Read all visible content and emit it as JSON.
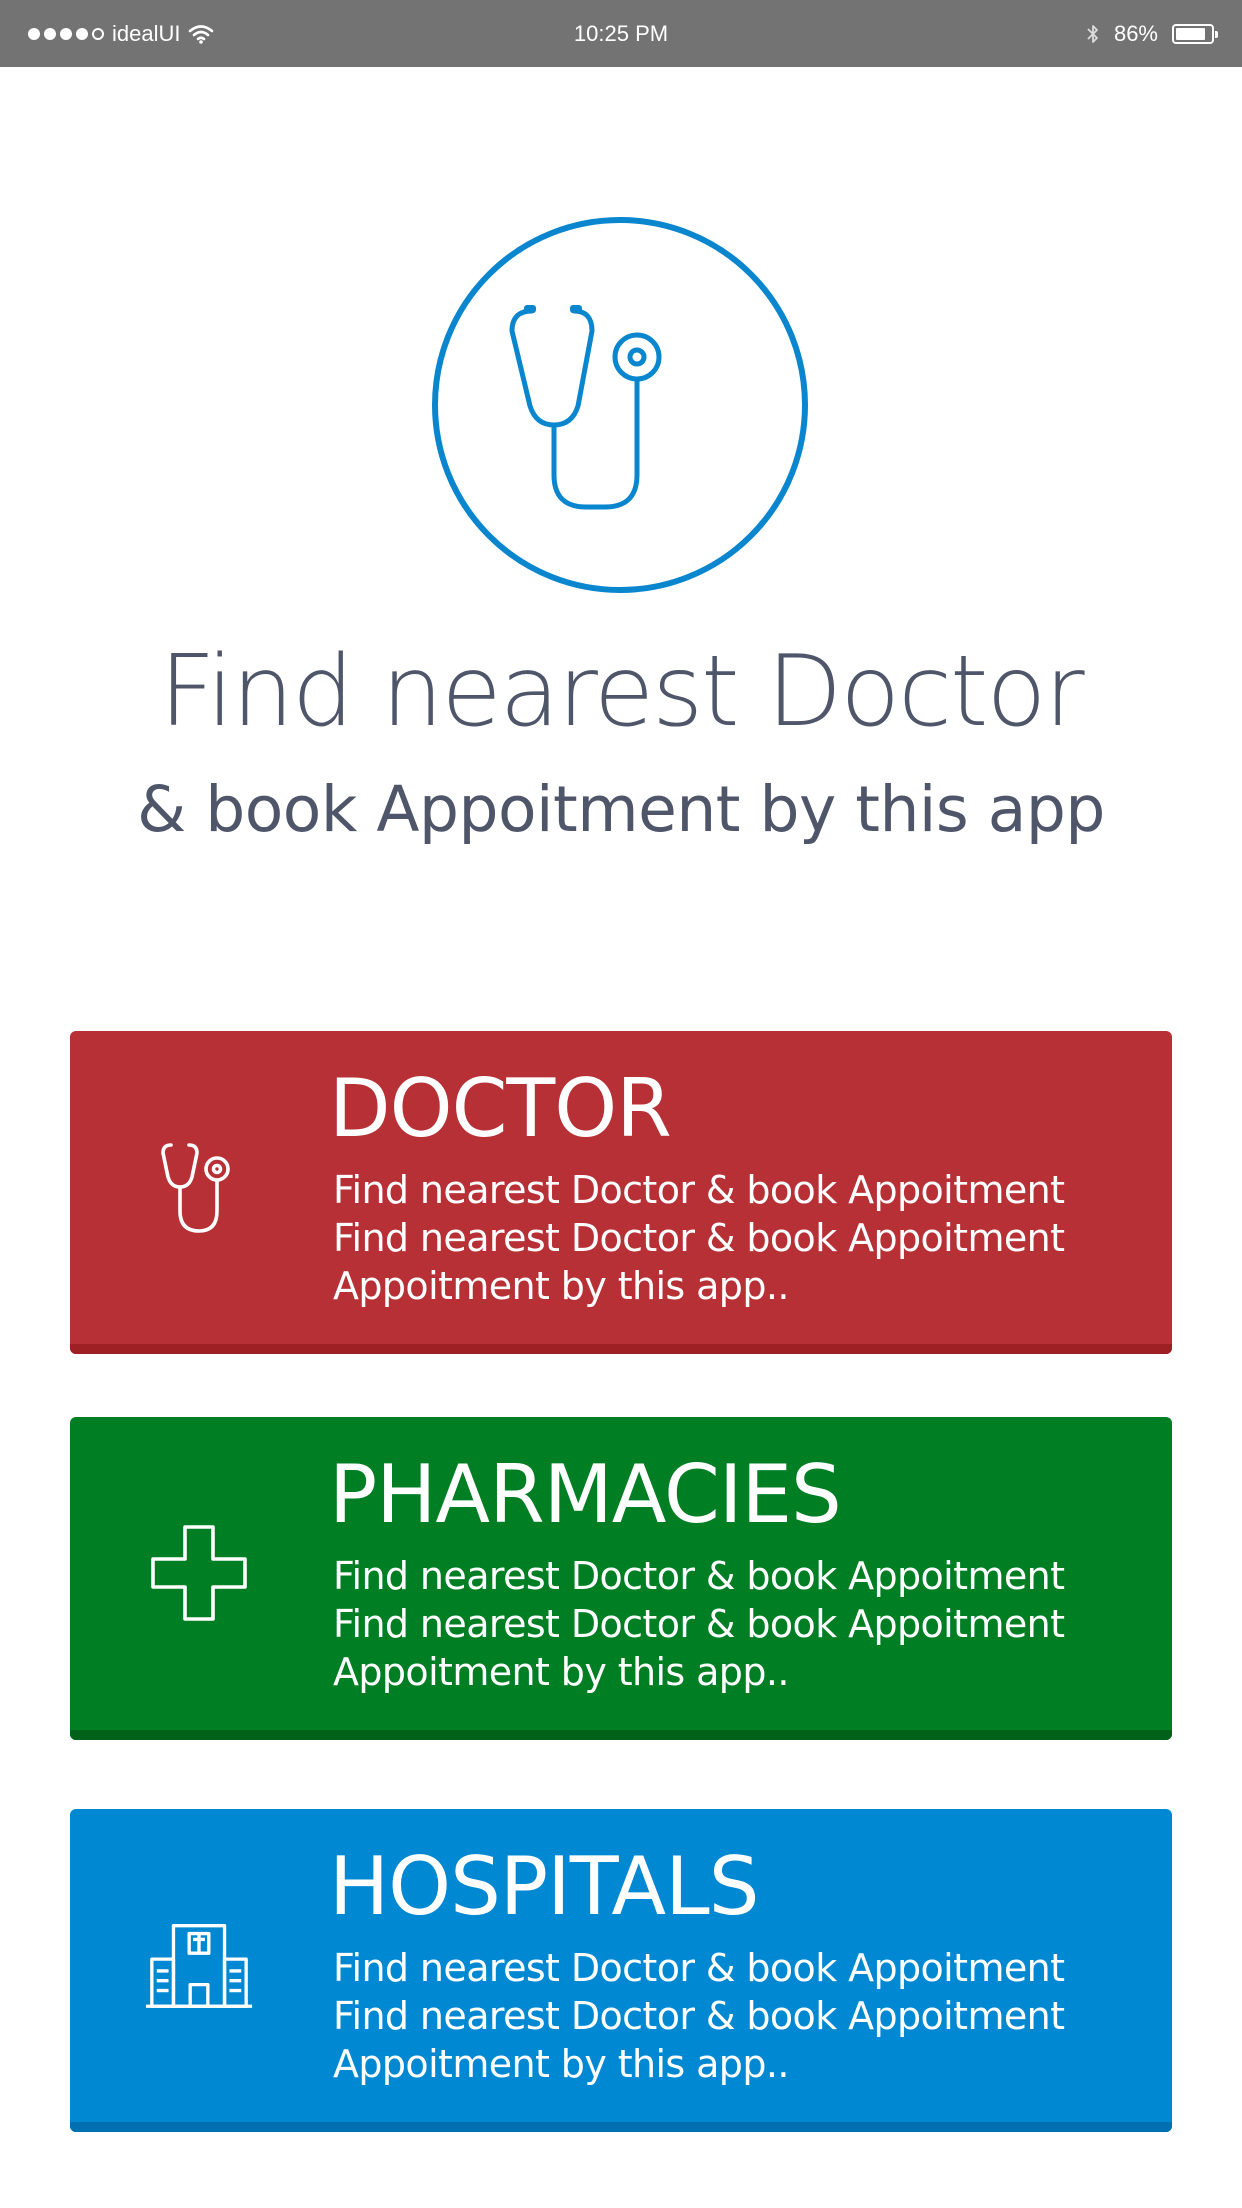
{
  "status_bar": {
    "carrier": "idealUI",
    "time": "10:25 PM",
    "battery_percent": "86%",
    "battery_level": 0.86,
    "signal_bars_filled": 4,
    "signal_bars_total": 5,
    "icons": [
      "wifi-icon",
      "bluetooth-icon",
      "battery-icon"
    ]
  },
  "hero": {
    "icon": "stethoscope-icon",
    "title": "Find nearest Doctor",
    "subtitle": "& book Appoitment by this app"
  },
  "colors": {
    "accent_blue": "#0a86cf",
    "text_dark": "#4f566a",
    "doctor_red": "#b63036",
    "pharmacy_green": "#007e23",
    "hospital_blue": "#0088d2"
  },
  "cards": [
    {
      "title": "DOCTOR",
      "icon": "stethoscope-icon",
      "lines": [
        "Find nearest Doctor & book Appoitment",
        "Find nearest Doctor & book Appoitment",
        "Appoitment by this app.."
      ]
    },
    {
      "title": "PHARMACIES",
      "icon": "medical-cross-icon",
      "lines": [
        "Find nearest Doctor & book Appoitment",
        "Find nearest Doctor & book Appoitment",
        "Appoitment by this app.."
      ]
    },
    {
      "title": "HOSPITALS",
      "icon": "hospital-icon",
      "lines": [
        "Find nearest Doctor & book Appoitment",
        "Find nearest Doctor & book Appoitment",
        "Appoitment by this app.."
      ]
    }
  ]
}
